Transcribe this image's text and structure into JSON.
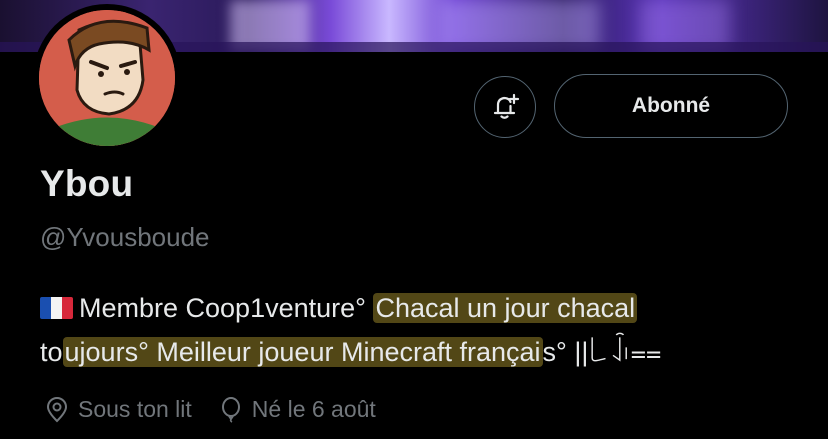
{
  "profile": {
    "display_name": "Ybou",
    "handle": "@Yvousboude",
    "bio": {
      "flag_icon": "flag-france-icon",
      "text_plain": "Membre Coop1venture°",
      "highlight_1": "Chacal un jour chacal",
      "line2_prefix": "to",
      "highlight_2": "ujours° Meilleur joueur Minecraft françai",
      "line2_suffix": "s° ||꒒ꀭ⩵"
    },
    "location": "Sous ton lit",
    "birthday": "Né le 6 août"
  },
  "actions": {
    "notification_icon": "bell-plus-icon",
    "follow_label": "Abonné"
  },
  "colors": {
    "background": "#000000",
    "text_primary": "#e7e9ea",
    "text_secondary": "#71767b",
    "highlight": "#6e6020"
  }
}
